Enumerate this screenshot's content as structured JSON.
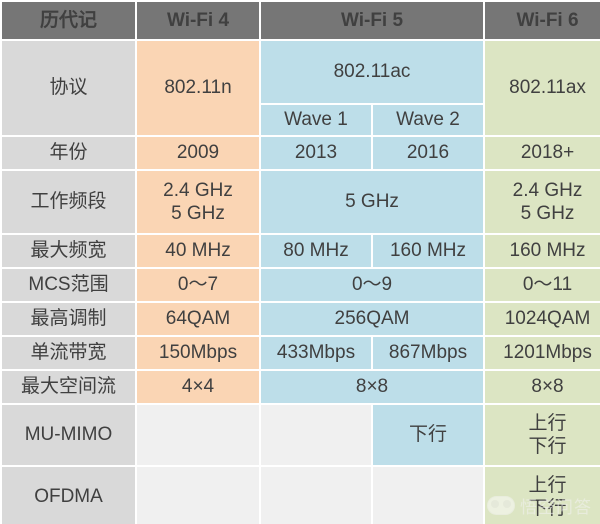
{
  "table": {
    "columns": {
      "label": "历代记",
      "wifi4": "Wi-Fi 4",
      "wifi5": "Wi-Fi 5",
      "wifi6": "Wi-Fi 6"
    },
    "rows": [
      {
        "label": "协议",
        "wifi4": "802.11n",
        "wifi5": "802.11ac",
        "wifi5_sub1": "Wave 1",
        "wifi5_sub2": "Wave 2",
        "wifi6": "802.11ax"
      },
      {
        "label": "年份",
        "wifi4": "2009",
        "wifi5_sub1": "2013",
        "wifi5_sub2": "2016",
        "wifi6": "2018+"
      },
      {
        "label": "工作频段",
        "wifi4": "2.4 GHz\n5 GHz",
        "wifi5": "5 GHz",
        "wifi6": "2.4 GHz\n5 GHz"
      },
      {
        "label": "最大频宽",
        "wifi4": "40 MHz",
        "wifi5_sub1": "80 MHz",
        "wifi5_sub2": "160 MHz",
        "wifi6": "160 MHz"
      },
      {
        "label": "MCS范围",
        "wifi4": "0～7",
        "wifi5": "0～9",
        "wifi6": "0～11"
      },
      {
        "label": "最高调制",
        "wifi4": "64QAM",
        "wifi5": "256QAM",
        "wifi6": "1024QAM"
      },
      {
        "label": "单流带宽",
        "wifi4": "150Mbps",
        "wifi5_sub1": "433Mbps",
        "wifi5_sub2": "867Mbps",
        "wifi6": "1201Mbps"
      },
      {
        "label": "最大空间流",
        "wifi4": "4×4",
        "wifi5": "8×8",
        "wifi6": "8×8"
      },
      {
        "label": "MU-MIMO",
        "wifi4": "",
        "wifi5_sub1": "",
        "wifi5_sub2": "下行",
        "wifi6": "上行\n下行"
      },
      {
        "label": "OFDMA",
        "wifi4": "",
        "wifi5_sub1": "",
        "wifi5_sub2": "",
        "wifi6": "上行\n下行"
      }
    ]
  },
  "watermark": {
    "text": "悟空问答"
  },
  "colors": {
    "header_bg": "#767676",
    "label_bg": "#D9D9D9",
    "wifi4_bg": "#FAD5B4",
    "wifi5_bg": "#BDDEE9",
    "wifi6_bg": "#DCE5C3",
    "empty_bg": "#F0F0F0",
    "text": "#404040"
  }
}
